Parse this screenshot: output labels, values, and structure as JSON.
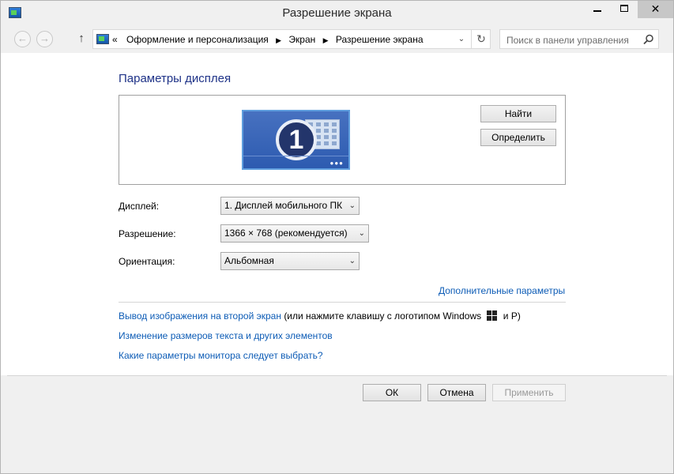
{
  "window": {
    "title": "Разрешение экрана"
  },
  "titlebar": {
    "close_glyph": "✕"
  },
  "nav": {
    "back_glyph": "←",
    "forward_glyph": "→",
    "up_glyph": "↑",
    "overflow_glyph": "«",
    "breadcrumbs": [
      "Оформление и персонализация",
      "Экран",
      "Разрешение экрана"
    ],
    "crumb_separator": "▶",
    "dropdown_glyph": "⌄",
    "refresh_glyph": "↻",
    "search_placeholder": "Поиск в панели управления"
  },
  "content": {
    "heading": "Параметры дисплея",
    "monitor_number": "1",
    "find_button": "Найти",
    "identify_button": "Определить",
    "display_label": "Дисплей:",
    "display_value": "1. Дисплей мобильного ПК",
    "resolution_label": "Разрешение:",
    "resolution_value": "1366 × 768 (рекомендуется)",
    "orientation_label": "Ориентация:",
    "orientation_value": "Альбомная",
    "dropdown_glyph": "⌄",
    "advanced_link": "Дополнительные параметры",
    "second_screen_link": "Вывод изображения на второй экран",
    "second_screen_hint_a": "(или нажмите клавишу с логотипом Windows",
    "second_screen_hint_b": "и P)",
    "text_size_link": "Изменение размеров текста и других элементов",
    "which_settings_link": "Какие параметры монитора следует выбрать?"
  },
  "footer": {
    "ok": "ОК",
    "cancel": "Отмена",
    "apply": "Применить"
  },
  "colors": {
    "link": "#0d5cb6",
    "heading": "#1e3287",
    "monitor": "#2d5bb0"
  }
}
